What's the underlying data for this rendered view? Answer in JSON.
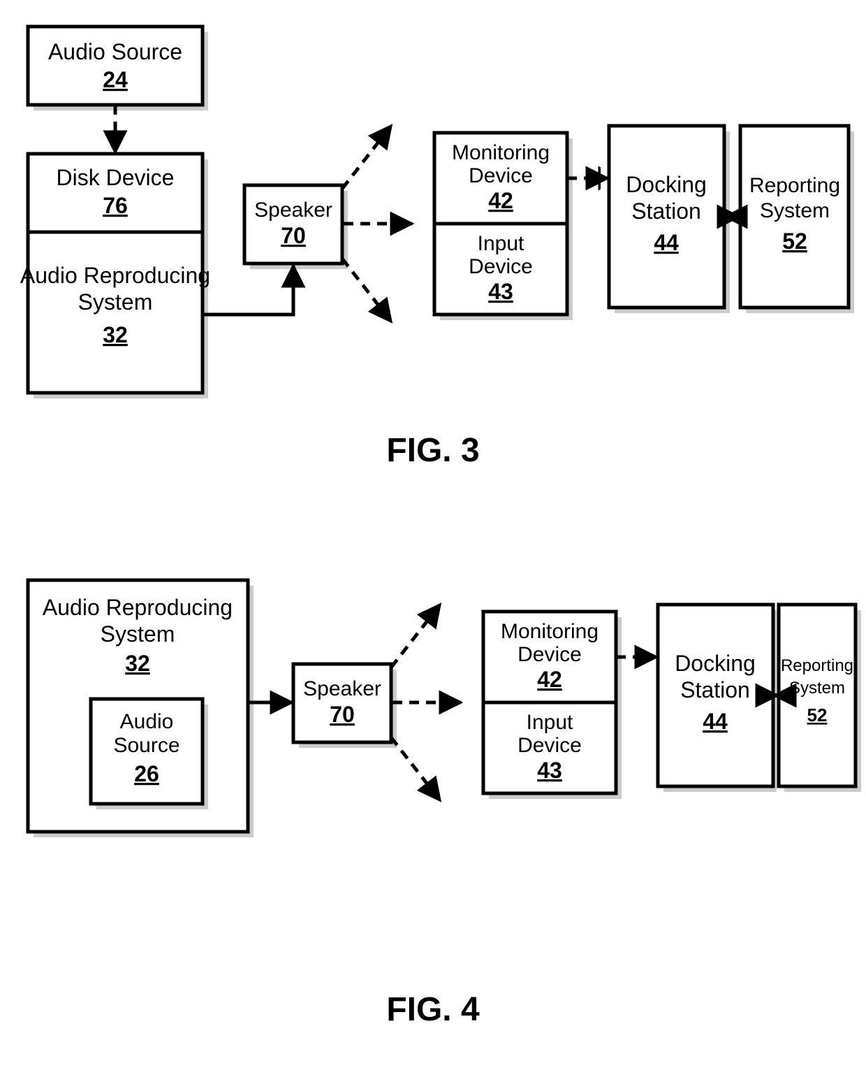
{
  "fig3": {
    "audio_source": {
      "line1": "Audio Source",
      "num": "24"
    },
    "disk_device": {
      "line1": "Disk Device",
      "num": "76"
    },
    "audio_system": {
      "line1": "Audio Reproducing",
      "line2": "System",
      "num": "32"
    },
    "speaker": {
      "line1": "Speaker",
      "num": "70"
    },
    "monitoring": {
      "line1": "Monitoring",
      "line2": "Device",
      "num": "42"
    },
    "input": {
      "line1": "Input",
      "line2": "Device",
      "num": "43"
    },
    "docking": {
      "line1": "Docking",
      "line2": "Station",
      "num": "44"
    },
    "reporting": {
      "line1": "Reporting",
      "line2": "System",
      "num": "52"
    },
    "caption": "FIG. 3"
  },
  "fig4": {
    "audio_system": {
      "line1": "Audio Reproducing",
      "line2": "System",
      "num": "32"
    },
    "audio_source": {
      "line1": "Audio",
      "line2": "Source",
      "num": "26"
    },
    "speaker": {
      "line1": "Speaker",
      "num": "70"
    },
    "monitoring": {
      "line1": "Monitoring",
      "line2": "Device",
      "num": "42"
    },
    "input": {
      "line1": "Input",
      "line2": "Device",
      "num": "43"
    },
    "docking": {
      "line1": "Docking",
      "line2": "Station",
      "num": "44"
    },
    "reporting": {
      "line1": "Reporting",
      "line2": "System",
      "num": "52"
    },
    "caption": "FIG. 4"
  }
}
